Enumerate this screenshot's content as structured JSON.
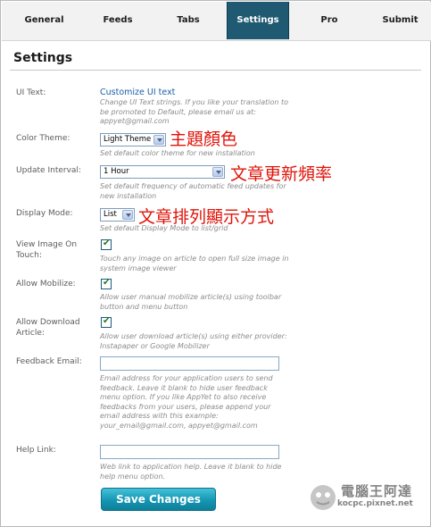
{
  "tabs": [
    {
      "label": "General",
      "active": false
    },
    {
      "label": "Feeds",
      "active": false
    },
    {
      "label": "Tabs",
      "active": false
    },
    {
      "label": "Settings",
      "active": true
    },
    {
      "label": "Pro",
      "active": false
    },
    {
      "label": "Submit",
      "active": false
    }
  ],
  "page_title": "Settings",
  "ui_text": {
    "label": "UI Text:",
    "link": "Customize UI text",
    "desc": "Change UI Text strings. If you like your translation to be promoted to Default, please email us at: appyet@gmail.com"
  },
  "color_theme": {
    "label": "Color Theme:",
    "value": "Light Theme",
    "desc": "Set default color theme for new installation",
    "annotation": "主題顏色"
  },
  "update_interval": {
    "label": "Update Interval:",
    "value": "1 Hour",
    "desc": "Set default frequency of automatic feed updates for new installation",
    "annotation": "文章更新頻率"
  },
  "display_mode": {
    "label": "Display Mode:",
    "value": "List",
    "desc": "Set default Display Mode to list/grid",
    "annotation": "文章排列顯示方式"
  },
  "view_image": {
    "label": "View Image On Touch:",
    "checked": true,
    "desc": "Touch any image on article to open full size image in system image viewer"
  },
  "allow_mobilize": {
    "label": "Allow Mobilize:",
    "checked": true,
    "desc": "Allow user manual mobilize article(s) using toolbar button and menu button"
  },
  "allow_download": {
    "label": "Allow Download Article:",
    "checked": true,
    "desc": "Allow user download article(s) using either provider: Instapaper or Google Mobilizer"
  },
  "feedback_email": {
    "label": "Feedback Email:",
    "value": "",
    "desc": "Email address for your application users to send feedback. Leave it blank to hide user feedback menu option. If you like AppYet to also receive feedbacks from your users, please append your email address with this example: your_email@gmail.com, appyet@gmail.com"
  },
  "help_link": {
    "label": "Help Link:",
    "value": "",
    "desc": "Web link to application help. Leave it blank to hide help menu option."
  },
  "save_label": "Save Changes",
  "watermark": {
    "title": "電腦王阿達",
    "url": "kocpc.pixnet.net"
  },
  "colors": {
    "active_tab": "#1f5a72",
    "link": "#1a5fa8",
    "annotation": "#e0140a",
    "button": "#1496b3"
  }
}
